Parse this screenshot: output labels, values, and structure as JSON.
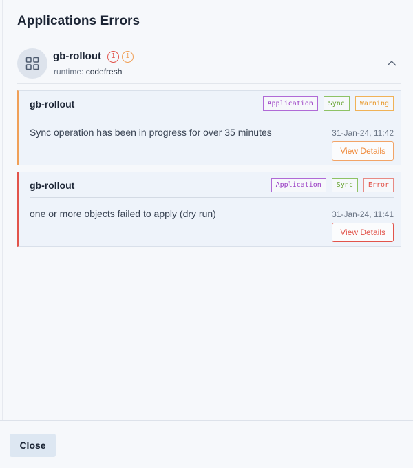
{
  "dialog": {
    "title": "Applications Errors",
    "close_label": "Close"
  },
  "app": {
    "name": "gb-rollout",
    "error_count": "1",
    "warning_count": "1",
    "runtime_label": "runtime:",
    "runtime_value": "codefresh",
    "icon": "grid-icon",
    "expanded": true
  },
  "errors": [
    {
      "title": "gb-rollout",
      "tags": [
        "Application",
        "Sync",
        "Warning"
      ],
      "message": "Sync operation has been in progress for over 35 minutes",
      "time": "31-Jan-24, 11:42",
      "action": "View Details",
      "severity": "warning"
    },
    {
      "title": "gb-rollout",
      "tags": [
        "Application",
        "Sync",
        "Error"
      ],
      "message": "one or more objects failed to apply (dry run)",
      "time": "31-Jan-24, 11:41",
      "action": "View Details",
      "severity": "error"
    }
  ],
  "colors": {
    "warning": "#f0a058",
    "error": "#e2544b",
    "application_tag": "#9b3fc4",
    "sync_tag": "#6aa534"
  }
}
